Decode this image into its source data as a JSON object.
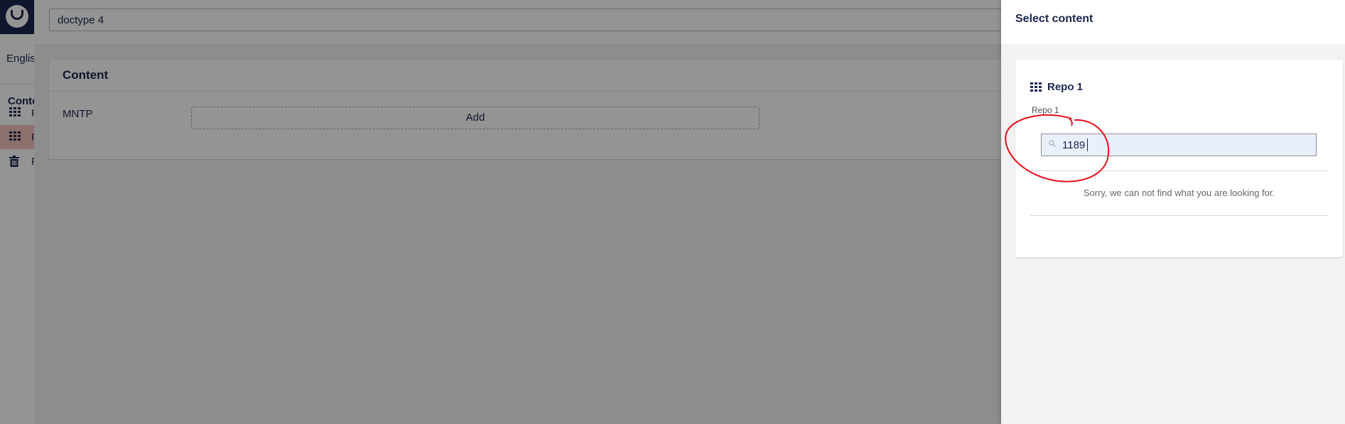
{
  "app": {
    "language": "English",
    "section": "Content",
    "tree_items": [
      {
        "label": "R",
        "icon": "grid-icon",
        "active": false
      },
      {
        "label": "R",
        "icon": "grid-icon",
        "active": true
      },
      {
        "label": "R",
        "icon": "trash-icon",
        "active": false
      }
    ]
  },
  "editor": {
    "name_value": "doctype 4",
    "group_title": "Content",
    "property_label": "MNTP",
    "add_label": "Add"
  },
  "picker": {
    "title": "Select content",
    "root_name": "Repo 1",
    "breadcrumb": "Repo 1",
    "search_value": "1189",
    "empty_message": "Sorry, we can not find what you are looking for."
  },
  "colors": {
    "brand": "#1b264f",
    "active_item": "#f5c1bc",
    "annotation": "#e8101c"
  }
}
